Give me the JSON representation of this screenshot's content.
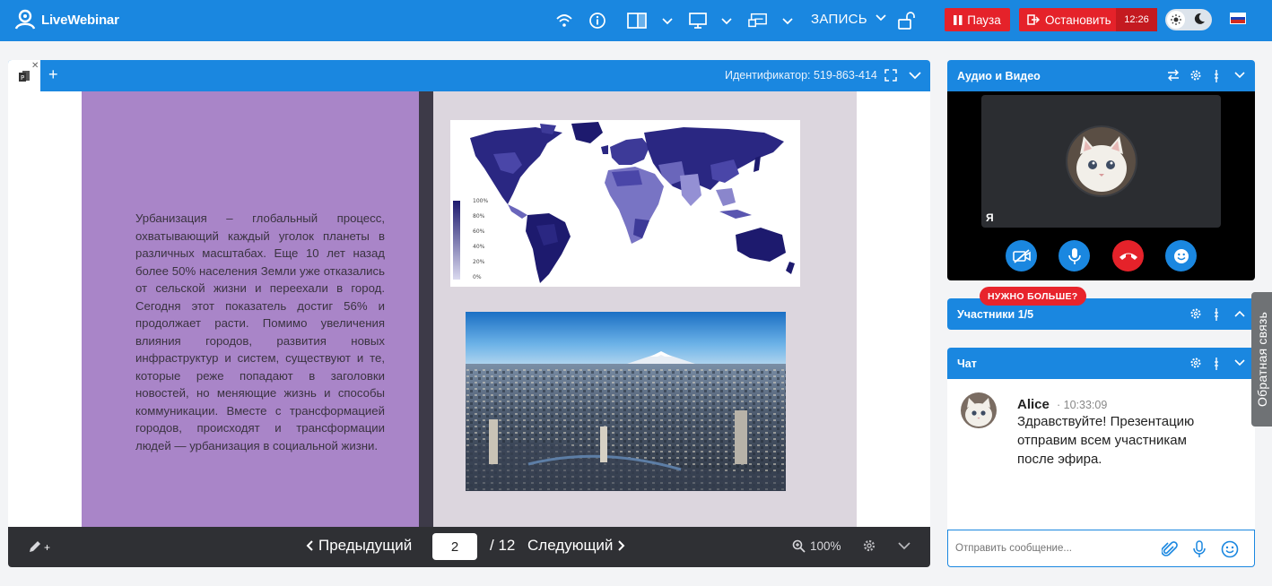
{
  "app": {
    "name": "LiveWebinar"
  },
  "topbar": {
    "record_label": "ЗАПИСЬ",
    "pause_label": "Пауза",
    "stop_label": "Остановить",
    "timer": "12:26"
  },
  "presentation": {
    "identifier": "Идентификатор: 519-863-414",
    "slide_text": "Урбанизация – глобальный процесс, охватывающий каждый уголок планеты в различных масштабах. Еще 10 лет назад более 50% населения Земли уже отказались от сельской жизни и переехали в город. Сегодня этот показатель достиг 56% и продолжает расти. Помимо увеличения влияния городов, развития новых инфраструктур и систем, существуют и те, которые реже попадают в заголовки новостей, но меняющие жизнь и способы коммуникации. Вместе с трансформацией городов, происходят и трансформации людей — урбанизация в социальной жизни.",
    "map_legend": [
      "100%",
      "80%",
      "60%",
      "40%",
      "20%",
      "0%"
    ],
    "footer": {
      "prev_label": "Предыдущий",
      "next_label": "Следующий",
      "current_page": "2",
      "total_pages": "/ 12",
      "zoom": "100%"
    }
  },
  "audio_video": {
    "title": "Аудио и Видео",
    "self_label": "Я"
  },
  "participants": {
    "title": "Участники 1/5",
    "upsell_badge": "НУЖНО БОЛЬШЕ?"
  },
  "chat": {
    "title": "Чат",
    "messages": [
      {
        "author": "Alice",
        "time": "10:33:09",
        "text": "Здравствуйте! Презентацию отправим всем участникам после эфира."
      }
    ],
    "input_placeholder": "Отправить сообщение..."
  },
  "feedback_label": "Обратная связь",
  "colors": {
    "primary": "#1a87e0",
    "danger": "#e5222a",
    "slide_purple": "#a985c8",
    "footer_dark": "#2f3034"
  },
  "icons": [
    "wifi-icon",
    "info-icon",
    "layout-icon",
    "screen-share-icon",
    "whiteboard-icon",
    "lock-icon",
    "sun-icon",
    "moon-icon",
    "ru-flag-icon",
    "document-icon",
    "fullscreen-icon",
    "pen-icon",
    "zoom-icon",
    "gear-icon",
    "swap-icon",
    "drag-icon",
    "camera-off-icon",
    "microphone-icon",
    "hangup-icon",
    "emoji-icon",
    "attachment-icon"
  ]
}
